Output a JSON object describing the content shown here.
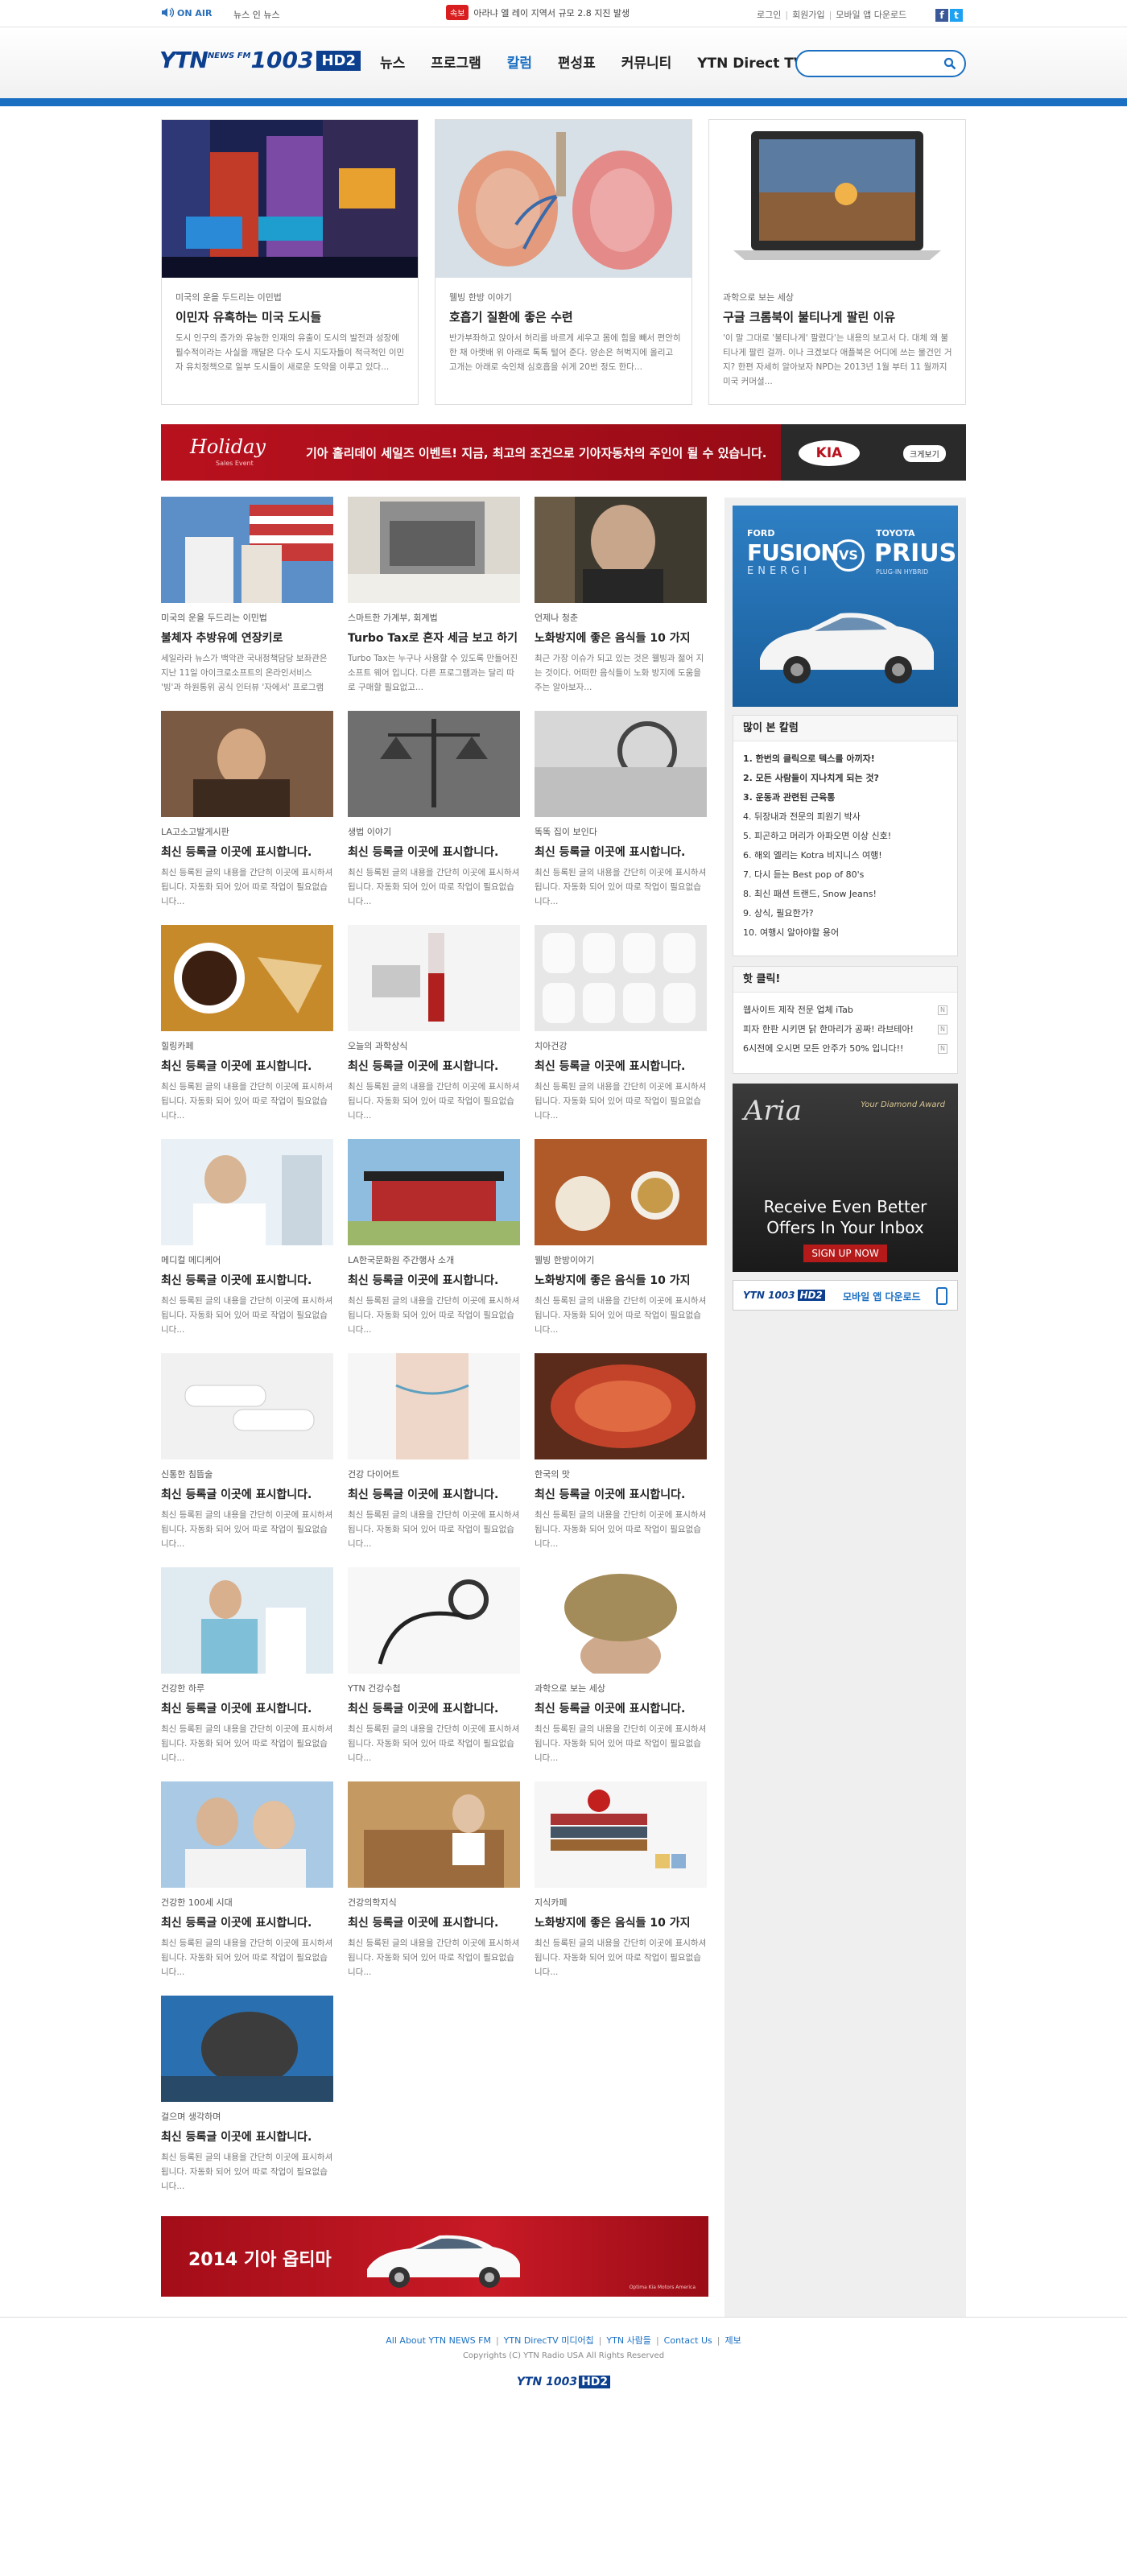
{
  "topbar": {
    "onair": "ON AIR",
    "news_live": "뉴스 인 뉴스",
    "breaking_tag": "속보",
    "breaking_text": "아라냐 엘 레이 지역서 규모 2.8 지진 발생",
    "links": [
      "로그인",
      "회원가입",
      "모바일 앱 다운로드"
    ],
    "sns": [
      "f",
      "t"
    ]
  },
  "header": {
    "logo_ytn": "YTN",
    "logo_newsfm": "NEWS FM",
    "logo_freq": "1003",
    "logo_hd": "HD2",
    "nav": [
      "뉴스",
      "프로그램",
      "칼럼",
      "편성표",
      "커뮤니티",
      "YTN Direct TV"
    ],
    "active_nav": "칼럼",
    "search_placeholder": ""
  },
  "featured": [
    {
      "cat": "미국의 운을 두드리는 이민법",
      "title": "이민자 유혹하는 미국 도시들",
      "desc": "도시 인구의 증가와 유능한 인재의 유출이 도시의 발전과 성장에 필수적이라는 사실을 깨달은 다수 도시 지도자들이 적극적인 이민자 유치정책으로 일부 도시들이 새로운 도약을 이루고 있다..."
    },
    {
      "cat": "웰빙 한방 이야기",
      "title": "호흡기 질환에 좋은 수련",
      "desc": "반가부좌하고 앉아서 허리를 바르게 세우고 몸에 힘을 빼서 편안히 한 채 아랫배 위 아래로 톡톡 털어 준다. 양손은 허벅지에 올리고 고개는 아래로 숙인채 심호흡을 쉬게 20번 정도 한다..."
    },
    {
      "cat": "과학으로 보는 세상",
      "title": "구글 크롬북이 불티나게 팔린 이유",
      "desc": "'이 말 그대로 '불티나게' 팔렸다'는 내용의 보고서 다. 대체 왜 불티나게 팔린 걸까. 이나 크겠보다 애플북은 어디에 쓰는 물건인 거지? 한편 자세히 알아보자 NPD는 2013년 1월 부터 11 월까지 미국 커머셜..."
    }
  ],
  "kia_banner": {
    "holiday": "Holiday",
    "sales_event": "Sales Event",
    "text": "기아 홀리데이 세일즈 이벤트! 지금, 최고의 조건으로 기아자동차의 주인이 될 수 있습니다.",
    "logo": "KIA",
    "enlarge": "크게보기"
  },
  "articles": [
    {
      "cat": "미국의 운을 두드리는 이민법",
      "title": "불체자 추방유예 연장키로",
      "desc": "세일라라 뉴스가 백악관 국내정책담당 보좌관은 지난 11일 아이크로소프트의 온라인서비스 '빙'과 하원통위 공식 인터뷰 '자에서' 프로그램에..."
    },
    {
      "cat": "스마트한 가계부, 회계법",
      "title": "Turbo Tax로 혼자 세금 보고 하기",
      "desc": "Turbo Tax는 누구나 사용할 수 있도록 만들어진 소프트 웨어 입니다. 다른 프로그램과는 달리 따로 구매할 필요없고..."
    },
    {
      "cat": "언제나 청춘",
      "title": "노화방지에 좋은 음식들 10 가지",
      "desc": "최근 가장 이슈가 되고 있는 것은 웰빙과 젊어 지는 것이다. 어떠한 음식들이 노화 방지에 도움을 주는 알아보자..."
    },
    {
      "cat": "LA고소고발게시판",
      "title": "최신 등록글 이곳에 표시합니다.",
      "desc": "최신 등록된 글의 내용을 간단히 이곳에 표시하셔 됩니다. 자동화 되어 있어 따로 작업이 필요없습니다..."
    },
    {
      "cat": "생법 이야기",
      "title": "최신 등록글 이곳에 표시합니다.",
      "desc": "최신 등록된 글의 내용을 간단히 이곳에 표시하셔 됩니다. 자동화 되어 있어 따로 작업이 필요없습니다..."
    },
    {
      "cat": "똑똑 집이 보인다",
      "title": "최신 등록글 이곳에 표시합니다.",
      "desc": "최신 등록된 글의 내용을 간단히 이곳에 표시하셔 됩니다. 자동화 되어 있어 따로 작업이 필요없습니다..."
    },
    {
      "cat": "힐링카페",
      "title": "최신 등록글 이곳에 표시합니다.",
      "desc": "최신 등록된 글의 내용을 간단히 이곳에 표시하셔 됩니다. 자동화 되어 있어 따로 작업이 필요없습니다..."
    },
    {
      "cat": "오늘의 과학상식",
      "title": "최신 등록글 이곳에 표시합니다.",
      "desc": "최신 등록된 글의 내용을 간단히 이곳에 표시하셔 됩니다. 자동화 되어 있어 따로 작업이 필요없습니다..."
    },
    {
      "cat": "치아건강",
      "title": "최신 등록글 이곳에 표시합니다.",
      "desc": "최신 등록된 글의 내용을 간단히 이곳에 표시하셔 됩니다. 자동화 되어 있어 따로 작업이 필요없습니다..."
    },
    {
      "cat": "메디컬 메디케어",
      "title": "최신 등록글 이곳에 표시합니다.",
      "desc": "최신 등록된 글의 내용을 간단히 이곳에 표시하셔 됩니다. 자동화 되어 있어 따로 작업이 필요없습니다..."
    },
    {
      "cat": "LA한국문화원 주간행사 소개",
      "title": "최신 등록글 이곳에 표시합니다.",
      "desc": "최신 등록된 글의 내용을 간단히 이곳에 표시하셔 됩니다. 자동화 되어 있어 따로 작업이 필요없습니다..."
    },
    {
      "cat": "웰빙 한방이야기",
      "title": "노화방지에 좋은 음식들 10 가지",
      "desc": "최신 등록된 글의 내용을 간단히 이곳에 표시하셔 됩니다. 자동화 되어 있어 따로 작업이 필요없습니다..."
    },
    {
      "cat": "신통한 침뜸술",
      "title": "최신 등록글 이곳에 표시합니다.",
      "desc": "최신 등록된 글의 내용을 간단히 이곳에 표시하셔 됩니다. 자동화 되어 있어 따로 작업이 필요없습니다..."
    },
    {
      "cat": "건강 다이어트",
      "title": "최신 등록글 이곳에 표시합니다.",
      "desc": "최신 등록된 글의 내용을 간단히 이곳에 표시하셔 됩니다. 자동화 되어 있어 따로 작업이 필요없습니다..."
    },
    {
      "cat": "한국의 맛",
      "title": "최신 등록글 이곳에 표시합니다.",
      "desc": "최신 등록된 글의 내용을 간단히 이곳에 표시하셔 됩니다. 자동화 되어 있어 따로 작업이 필요없습니다..."
    },
    {
      "cat": "건강한 하루",
      "title": "최신 등록글 이곳에 표시합니다.",
      "desc": "최신 등록된 글의 내용을 간단히 이곳에 표시하셔 됩니다. 자동화 되어 있어 따로 작업이 필요없습니다..."
    },
    {
      "cat": "YTN 건강수첩",
      "title": "최신 등록글 이곳에 표시합니다.",
      "desc": "최신 등록된 글의 내용을 간단히 이곳에 표시하셔 됩니다. 자동화 되어 있어 따로 작업이 필요없습니다..."
    },
    {
      "cat": "과학으로 보는 세상",
      "title": "최신 등록글 이곳에 표시합니다.",
      "desc": "최신 등록된 글의 내용을 간단히 이곳에 표시하셔 됩니다. 자동화 되어 있어 따로 작업이 필요없습니다..."
    },
    {
      "cat": "건강한 100세 시대",
      "title": "최신 등록글 이곳에 표시합니다.",
      "desc": "최신 등록된 글의 내용을 간단히 이곳에 표시하셔 됩니다. 자동화 되어 있어 따로 작업이 필요없습니다..."
    },
    {
      "cat": "건강의학지식",
      "title": "최신 등록글 이곳에 표시합니다.",
      "desc": "최신 등록된 글의 내용을 간단히 이곳에 표시하셔 됩니다. 자동화 되어 있어 따로 작업이 필요없습니다..."
    },
    {
      "cat": "지식카페",
      "title": "노화방지에 좋은 음식들 10 가지",
      "desc": "최신 등록된 글의 내용을 간단히 이곳에 표시하셔 됩니다. 자동화 되어 있어 따로 작업이 필요없습니다..."
    },
    {
      "cat": "걸으며 생각하며",
      "title": "최신 등록글 이곳에 표시합니다.",
      "desc": "최신 등록된 글의 내용을 간단히 이곳에 표시하셔 됩니다. 자동화 되어 있어 따로 작업이 필요없습니다..."
    }
  ],
  "sidebar": {
    "ford_ad": {
      "ford": "FORD",
      "fusion": "FUSION",
      "energi": "ENERGI",
      "vs": "VS",
      "toyota": "TOYOTA",
      "prius": "PRIUS",
      "plugin": "PLUG-IN HYBRID"
    },
    "popular_title": "많이 본 칼럼",
    "popular": [
      "1. 한번의 클릭으로 텍스를 아끼자!",
      "2. 모든 사람들이 지나치게 되는 것?",
      "3. 운동과 관련된 근육통",
      "4. 뒤장내과 전문의 피원기 박사",
      "5. 피곤하고 머리가 아파오면 이상 신호!",
      "6. 해외 엘리는 Kotra 비지니스 여행!",
      "7. 다시 듣는 Best pop of 80's",
      "8. 최신 패션 트랜드, Snow Jeans!",
      "9. 상식, 필요한가?",
      "10. 여행시 알아야할 용어"
    ],
    "hot_title": "핫 클릭!",
    "hot": [
      "웹사이트 제작 전문 업체 iTab",
      "피자 한판 시키면 닭 한마리가 공짜! 라브테아!",
      "6시전에 오시면 모든 안주가 50% 입니다!!"
    ],
    "new_badge": "N",
    "aria_ad": {
      "brand": "Aria",
      "headline1": "Receive Even Better",
      "headline2": "Offers In Your Inbox",
      "signup": "SIGN UP NOW",
      "rewards": "Your Diamond Award"
    },
    "mobile": {
      "logo": "YTN 1003",
      "hd": "HD2",
      "text": "모바일 앱 다운로드"
    }
  },
  "optima": {
    "text": "2014 기아 옵티마",
    "tiny": "Optima Kia Motors America"
  },
  "footer": {
    "links": [
      "All About YTN NEWS FM",
      "YTN DirecTV 미디어칩",
      "YTN 사람들",
      "Contact Us",
      "제보"
    ],
    "copyright": "Copyrights (C) YTN Radio USA All Rights Reserved",
    "logo": "YTN 1003",
    "hd": "HD2"
  }
}
